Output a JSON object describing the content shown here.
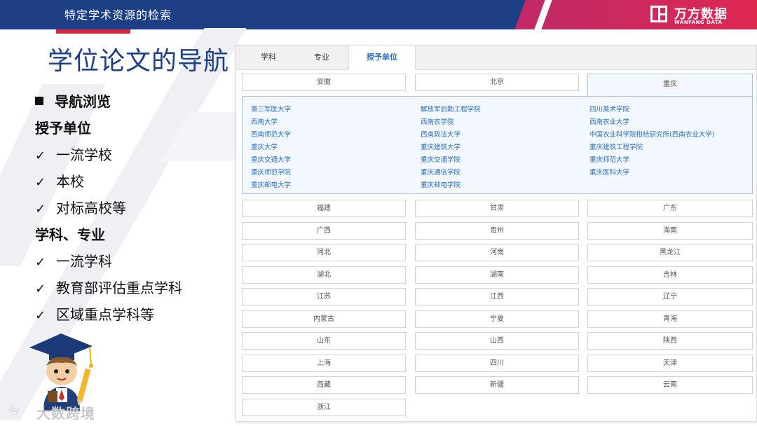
{
  "header": {
    "title": "特定学术资源的检索"
  },
  "logo": {
    "cn": "万方数据",
    "en": "WANFANG DATA"
  },
  "page_title": "学位论文的导航",
  "left": {
    "nav_browse": "导航浏览",
    "grant_unit": "授予单位",
    "grant_items": [
      "一流学校",
      "本校",
      "对标高校等"
    ],
    "discipline": "学科、专业",
    "discipline_items": [
      "一流学科",
      "教育部评估重点学科",
      "区域重点学科等"
    ],
    "check_mark": "✓"
  },
  "watermark": "大数跨境",
  "tabs": [
    {
      "label": "学科",
      "active": false
    },
    {
      "label": "专业",
      "active": false
    },
    {
      "label": "授予单位",
      "active": true
    }
  ],
  "regions_top": [
    "安徽",
    "北京",
    "重庆"
  ],
  "active_region": "重庆",
  "universities": [
    [
      "第三军医大学",
      "解放军后勤工程学院",
      "四川美术学院"
    ],
    [
      "西南大学",
      "西南农学院",
      "西南农业大学"
    ],
    [
      "西南师范大学",
      "西南政法大学",
      "中国农业科学院柑桔研究所(西南农业大学)"
    ],
    [
      "重庆大学",
      "重庆建筑大学",
      "重庆建筑工程学院"
    ],
    [
      "重庆交通大学",
      "重庆交通学院",
      "重庆师范大学"
    ],
    [
      "重庆师范学院",
      "重庆通信学院",
      "重庆医科大学"
    ],
    [
      "重庆邮电大学",
      "重庆邮电学院",
      ""
    ]
  ],
  "regions": [
    [
      "福建",
      "甘肃",
      "广东"
    ],
    [
      "广西",
      "贵州",
      "海南"
    ],
    [
      "河北",
      "河南",
      "黑龙江"
    ],
    [
      "湖北",
      "湖南",
      "吉林"
    ],
    [
      "江苏",
      "江西",
      "辽宁"
    ],
    [
      "内蒙古",
      "宁夏",
      "青海"
    ],
    [
      "山东",
      "山西",
      "陕西"
    ],
    [
      "上海",
      "四川",
      "天津"
    ],
    [
      "西藏",
      "新疆",
      "云南"
    ],
    [
      "浙江",
      "",
      ""
    ]
  ],
  "colors": {
    "brand_blue": "#1c3f86",
    "accent_red": "#d3283b",
    "link_blue": "#2a6ebd",
    "brand_pink": "#c12a66"
  }
}
